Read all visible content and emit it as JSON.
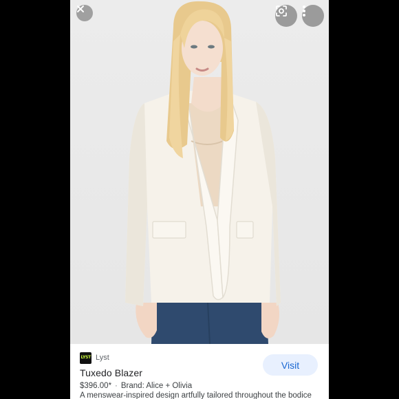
{
  "overlay": {
    "close_icon": "close-icon",
    "lens_icon": "google-lens-icon",
    "more_icon": "more-vertical-icon"
  },
  "product": {
    "source_logo_text": "LYST",
    "source_name": "Lyst",
    "title": "Tuxedo Blazer",
    "price": "$396.00*",
    "separator": "·",
    "brand": "Brand: Alice + Olivia",
    "description": "A menswear-inspired design artfully tailored throughout the bodice",
    "visit_label": "Visit"
  },
  "colors": {
    "visit_bg": "#e8f0fe",
    "visit_text": "#1967d2",
    "logo_bg": "#111111",
    "logo_text": "#c9f83b"
  }
}
